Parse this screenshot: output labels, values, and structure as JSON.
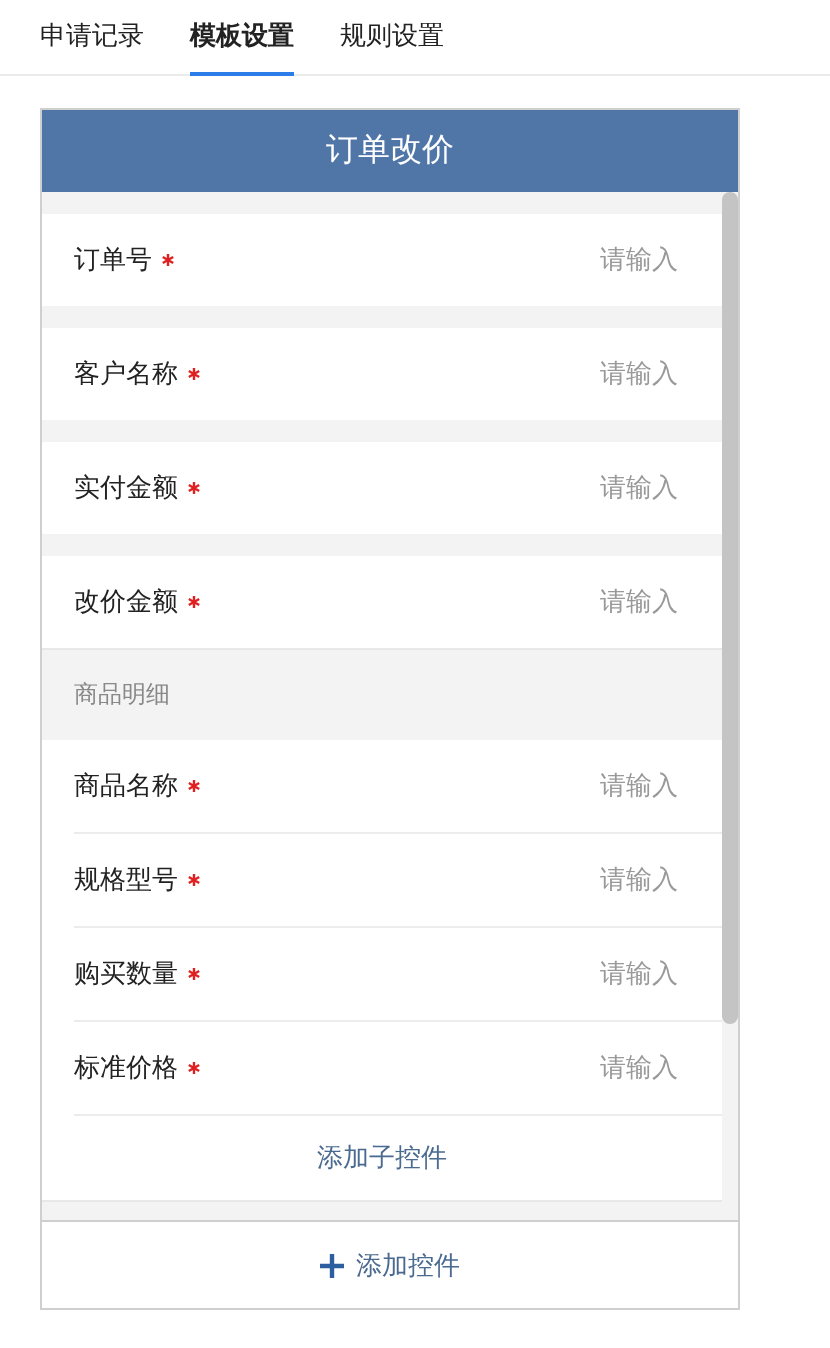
{
  "tabs": [
    {
      "label": "申请记录",
      "selected": false
    },
    {
      "label": "模板设置",
      "selected": true
    },
    {
      "label": "规则设置",
      "selected": false
    }
  ],
  "form": {
    "title": "订单改价",
    "fields": [
      {
        "label": "订单号",
        "required": true,
        "placeholder": "请输入"
      },
      {
        "label": "客户名称",
        "required": true,
        "placeholder": "请输入"
      },
      {
        "label": "实付金额",
        "required": true,
        "placeholder": "请输入"
      },
      {
        "label": "改价金额",
        "required": true,
        "placeholder": "请输入"
      }
    ],
    "detail": {
      "title": "商品明细",
      "fields": [
        {
          "label": "商品名称",
          "required": true,
          "placeholder": "请输入"
        },
        {
          "label": "规格型号",
          "required": true,
          "placeholder": "请输入"
        },
        {
          "label": "购买数量",
          "required": true,
          "placeholder": "请输入"
        },
        {
          "label": "标准价格",
          "required": true,
          "placeholder": "请输入"
        }
      ],
      "add_child": "添加子控件"
    },
    "add_control": "添加控件"
  }
}
